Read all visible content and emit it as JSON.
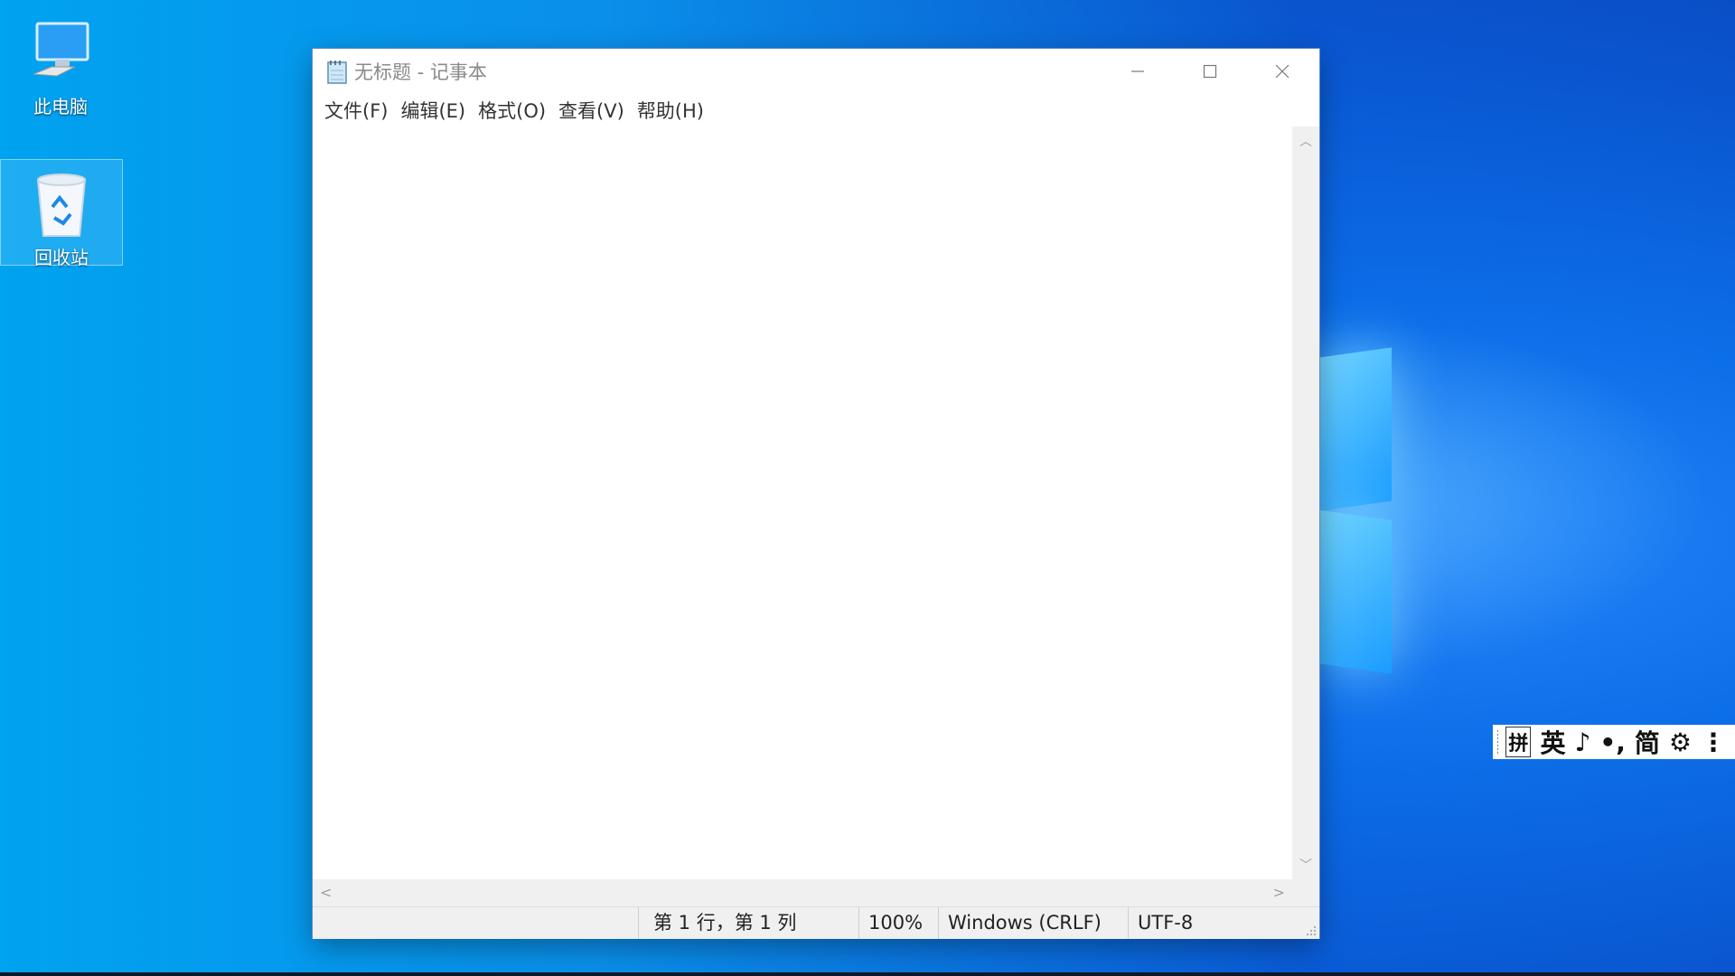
{
  "desktop": {
    "icons": [
      {
        "label": "此电脑",
        "icon": "computer-icon"
      },
      {
        "label": "回收站",
        "icon": "recycle-bin-icon"
      }
    ]
  },
  "notepad": {
    "title": "无标题 - 记事本",
    "menu": [
      "文件(F)",
      "编辑(E)",
      "格式(O)",
      "查看(V)",
      "帮助(H)"
    ],
    "content": "",
    "status": {
      "position": "第 1 行，第 1 列",
      "zoom": "100%",
      "line_ending": "Windows (CRLF)",
      "encoding": "UTF-8"
    }
  },
  "ime_toolbar": {
    "items": [
      "拼",
      "英",
      "♪",
      "•,",
      "简",
      "⚙",
      "⋮"
    ]
  },
  "colors": {
    "desktop_accent": "#0a8fea",
    "window_border": "#5a8ac8"
  }
}
